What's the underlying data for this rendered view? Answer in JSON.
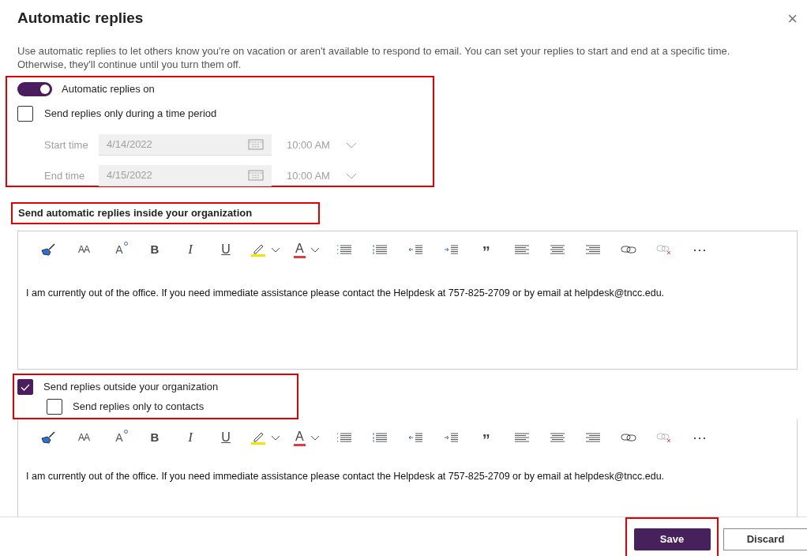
{
  "dialog": {
    "title": "Automatic replies",
    "close_label": "×",
    "description": "Use automatic replies to let others know you're on vacation or aren't available to respond to email. You can set your replies to start and end at a specific time. Otherwise, they'll continue until you turn them off."
  },
  "auto_replies": {
    "label": "Automatic replies on",
    "on": true
  },
  "time_period": {
    "label": "Send replies only during a time period",
    "checked": false,
    "disabled": true,
    "rows": [
      {
        "label": "Start time",
        "date": "4/14/2022",
        "time": "10:00 AM"
      },
      {
        "label": "End time",
        "date": "4/15/2022",
        "time": "10:00 AM"
      }
    ]
  },
  "inside": {
    "heading": "Send automatic replies inside your organization",
    "toolbar": [
      {
        "kind": "format-painter"
      },
      {
        "kind": "font-size",
        "label": "AA"
      },
      {
        "kind": "text-effects",
        "label": "A"
      },
      {
        "kind": "bold",
        "label": "B"
      },
      {
        "kind": "italic",
        "label": "I"
      },
      {
        "kind": "underline",
        "label": "U"
      },
      {
        "kind": "highlight"
      },
      {
        "kind": "font-color",
        "label": "A"
      },
      {
        "kind": "bullets"
      },
      {
        "kind": "numbering"
      },
      {
        "kind": "outdent"
      },
      {
        "kind": "indent"
      },
      {
        "kind": "quote",
        "label": "”"
      },
      {
        "kind": "align-left"
      },
      {
        "kind": "align-center"
      },
      {
        "kind": "align-right"
      },
      {
        "kind": "link"
      },
      {
        "kind": "unlink",
        "disabled": true
      },
      {
        "kind": "more",
        "label": "⋯"
      }
    ],
    "message": "I am currently out of the office. If you need immediate assistance please contact the Helpdesk at 757-825-2709 or by email at helpdesk@tncc.edu."
  },
  "outside": {
    "label": "Send replies outside your organization",
    "checked": true,
    "contacts_label": "Send replies only to contacts",
    "contacts_checked": false,
    "toolbar": [
      {
        "kind": "format-painter"
      },
      {
        "kind": "font-size",
        "label": "AA"
      },
      {
        "kind": "text-effects",
        "label": "A"
      },
      {
        "kind": "bold",
        "label": "B"
      },
      {
        "kind": "italic",
        "label": "I"
      },
      {
        "kind": "underline",
        "label": "U"
      },
      {
        "kind": "highlight"
      },
      {
        "kind": "font-color",
        "label": "A"
      },
      {
        "kind": "bullets"
      },
      {
        "kind": "numbering"
      },
      {
        "kind": "outdent"
      },
      {
        "kind": "indent"
      },
      {
        "kind": "quote",
        "label": "”"
      },
      {
        "kind": "align-left"
      },
      {
        "kind": "align-center"
      },
      {
        "kind": "align-right"
      },
      {
        "kind": "link"
      },
      {
        "kind": "unlink",
        "disabled": true
      },
      {
        "kind": "more",
        "label": "⋯"
      }
    ],
    "message": "I am currently out of the office. If you need immediate assistance please contact the Helpdesk at 757-825-2709 or by email at helpdesk@tncc.edu."
  },
  "buttons": [
    {
      "label": "Save",
      "primary": true
    },
    {
      "label": "Discard",
      "primary": false
    }
  ]
}
